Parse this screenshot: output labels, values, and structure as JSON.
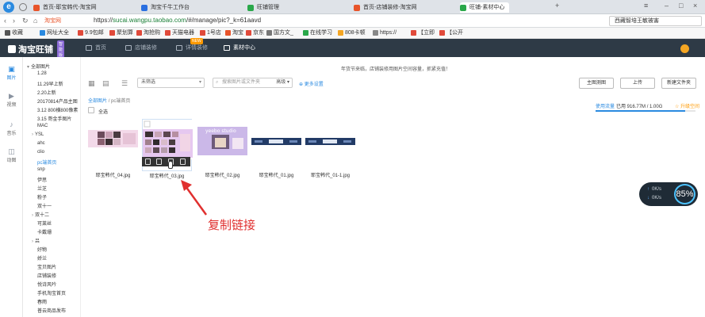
{
  "browser": {
    "tabs": [
      {
        "label": "首页-耶宝韩代-淘宝网",
        "color": "#e8542a"
      },
      {
        "label": "淘宝千牛工作台",
        "color": "#2a6fe0"
      },
      {
        "label": "旺铺管理",
        "color": "#2aa84a"
      },
      {
        "label": "首页-店铺装修-淘宝网",
        "color": "#e8542a"
      },
      {
        "label": "旺铺-素材中心",
        "color": "#2aa84a"
      }
    ],
    "url_prefix": "https://",
    "url_host": "sucai.wangpu.taobao.com",
    "url_path": "/#/manage/pic?_k=61aavd",
    "site_label": "淘宝网",
    "search_text": "西藏智培王敏被害"
  },
  "favorites": [
    "收藏",
    "网址大全",
    "9.9包邮",
    "聚划算",
    "淘抢购",
    "天猫电器",
    "1号店",
    "淘宝",
    "京东",
    "国方文_",
    "在线学习",
    "808卡顿",
    "https://",
    "【立即",
    "【公开"
  ],
  "topnav": {
    "brand": "淘宝旺铺",
    "badge": "智能版",
    "items": [
      {
        "label": "首页",
        "hot": ""
      },
      {
        "label": "店铺装修",
        "hot": ""
      },
      {
        "label": "详情装修",
        "hot": "NEW"
      },
      {
        "label": "素材中心",
        "hot": ""
      }
    ]
  },
  "sidebar_icons": [
    {
      "label": "图片",
      "icon": "image-icon"
    },
    {
      "label": "视频",
      "icon": "video-icon"
    },
    {
      "label": "音乐",
      "icon": "music-icon"
    },
    {
      "label": "动图",
      "icon": "gif-icon"
    }
  ],
  "folders": [
    "全部图片",
    "1.28",
    "11.29早上新",
    "2.20上新",
    "20170814产品主图",
    "3.12 800横800像素",
    "3.15 哥金手图片",
    "MAC",
    "YSL",
    "ahc",
    "clio",
    "pc端首页",
    "snp",
    "伊思",
    "兰芝",
    "粉子",
    "双十一",
    "双十二",
    "可莱丝",
    "卡戴珊",
    "吕",
    "好物",
    "娇兰",
    "宝贝图片",
    "店铺装修",
    "悦诗风吟",
    "手机淘宝首页",
    "春雨",
    "普云商品发布"
  ],
  "selected_folder": "pc端首页",
  "notice": "年货节来临，店铺装修用图片空间容量，抓紧充值！",
  "toolbar": {
    "filter": "未筛选",
    "search_placeholder": "搜索图片或文件夹",
    "advanced": "高级",
    "more_settings": "更多设置",
    "btn_theme": "主图测图",
    "btn_upload": "上传",
    "btn_new_folder": "新建文件夹"
  },
  "breadcrumb": {
    "root": "全部图片",
    "sep": "/",
    "current": "pc端首页"
  },
  "select_all": "全选",
  "usage": {
    "label": "使用流量",
    "value": "已用 916.77M / 1.00G",
    "upgrade": "升级空间",
    "fraction": 0.9
  },
  "images": [
    {
      "name": "耶宝韩代_04.jpg",
      "style": "banner-light"
    },
    {
      "name": "耶宝韩代_03.jpg",
      "style": "collage"
    },
    {
      "name": "耶宝韩代_02.jpg",
      "style": "studio",
      "text": "yeebo studio"
    },
    {
      "name": "耶宝韩代_01.jpg",
      "style": "strip"
    },
    {
      "name": "耶宝韩代_01-1.jpg",
      "style": "strip"
    }
  ],
  "annotation": "复制链接",
  "speed": {
    "up": "0K/s",
    "down": "0K/s",
    "percent": "85%"
  }
}
